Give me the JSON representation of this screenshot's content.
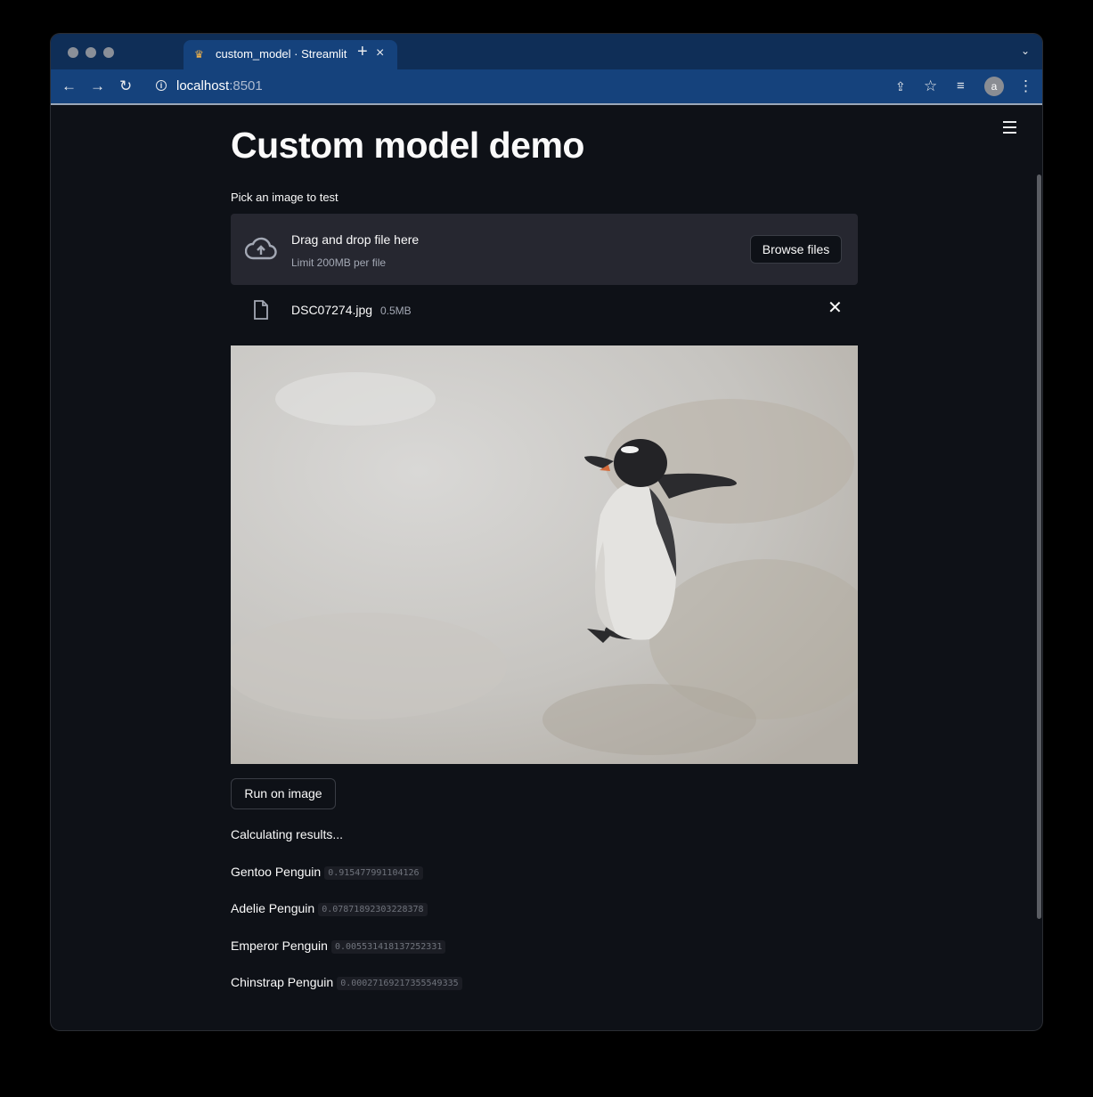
{
  "browser": {
    "tab_title": "custom_model · Streamlit",
    "url_host": "localhost",
    "url_port": ":8501",
    "avatar_letter": "a"
  },
  "app": {
    "title": "Custom model demo",
    "uploader": {
      "label": "Pick an image to test",
      "drop_text": "Drag and drop file here",
      "limit_text": "Limit 200MB per file",
      "browse_label": "Browse files"
    },
    "file": {
      "name": "DSC07274.jpg",
      "size": "0.5MB"
    },
    "run_button": "Run on image",
    "status_text": "Calculating results...",
    "results": [
      {
        "label": "Gentoo Penguin",
        "score": "0.915477991104126"
      },
      {
        "label": "Adelie Penguin",
        "score": "0.07871892303228378"
      },
      {
        "label": "Emperor Penguin",
        "score": "0.005531418137252331"
      },
      {
        "label": "Chinstrap Penguin",
        "score": "0.00027169217355549335"
      }
    ]
  },
  "icons": {
    "tab_favicon": "streamlit-crown-icon",
    "upload": "cloud-upload-icon",
    "file": "file-icon"
  },
  "colors": {
    "tabstrip": "#0f2e57",
    "toolbar": "#15427c",
    "app_background": "#0e1117",
    "dropzone": "#262730"
  }
}
